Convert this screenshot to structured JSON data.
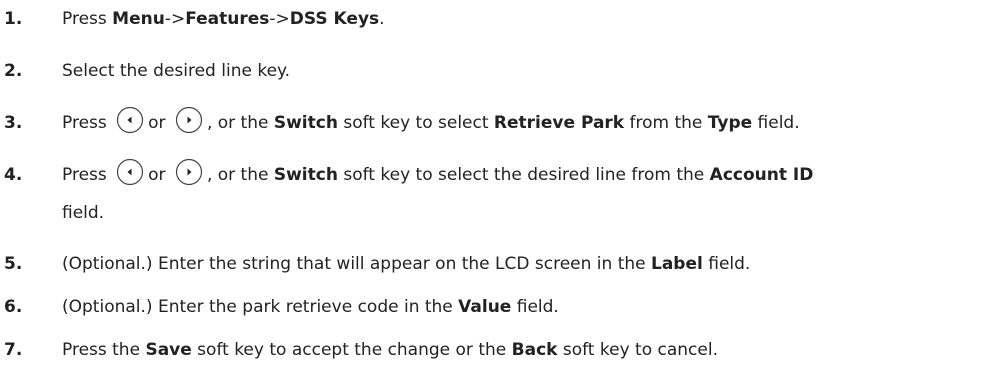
{
  "steps": [
    {
      "num": "1.",
      "parts": {
        "t1": "Press ",
        "b1": "Menu",
        "t2": "->",
        "b2": "Features",
        "t3": "->",
        "b3": "DSS Keys",
        "t4": "."
      }
    },
    {
      "num": "2.",
      "parts": {
        "t1": "Select the desired line key."
      }
    },
    {
      "num": "3.",
      "parts": {
        "t1": "Press",
        "t2": "or",
        "t3": ", or the ",
        "b1": "Switch",
        "t4": " soft key to select ",
        "b2": "Retrieve Park",
        "t5": " from the ",
        "b3": "Type",
        "t6": " field."
      }
    },
    {
      "num": "4.",
      "parts": {
        "t1": "Press",
        "t2": "or",
        "t3": ", or the ",
        "b1": "Switch",
        "t4": " soft key to select the desired line from the ",
        "b2": "Account ID",
        "t5": "field."
      }
    },
    {
      "num": "5.",
      "parts": {
        "t1": "(Optional.) Enter the string that will appear on the LCD screen in the ",
        "b1": "Label",
        "t2": " field."
      }
    },
    {
      "num": "6.",
      "parts": {
        "t1": "(Optional.) Enter the park retrieve code in the ",
        "b1": "Value",
        "t2": " field."
      }
    },
    {
      "num": "7.",
      "parts": {
        "t1": "Press the ",
        "b1": "Save",
        "t2": " soft key to accept the change or the ",
        "b2": "Back",
        "t3": " soft key to cancel."
      }
    }
  ],
  "icons": {
    "left": "left-arrow-key-icon",
    "right": "right-arrow-key-icon"
  }
}
